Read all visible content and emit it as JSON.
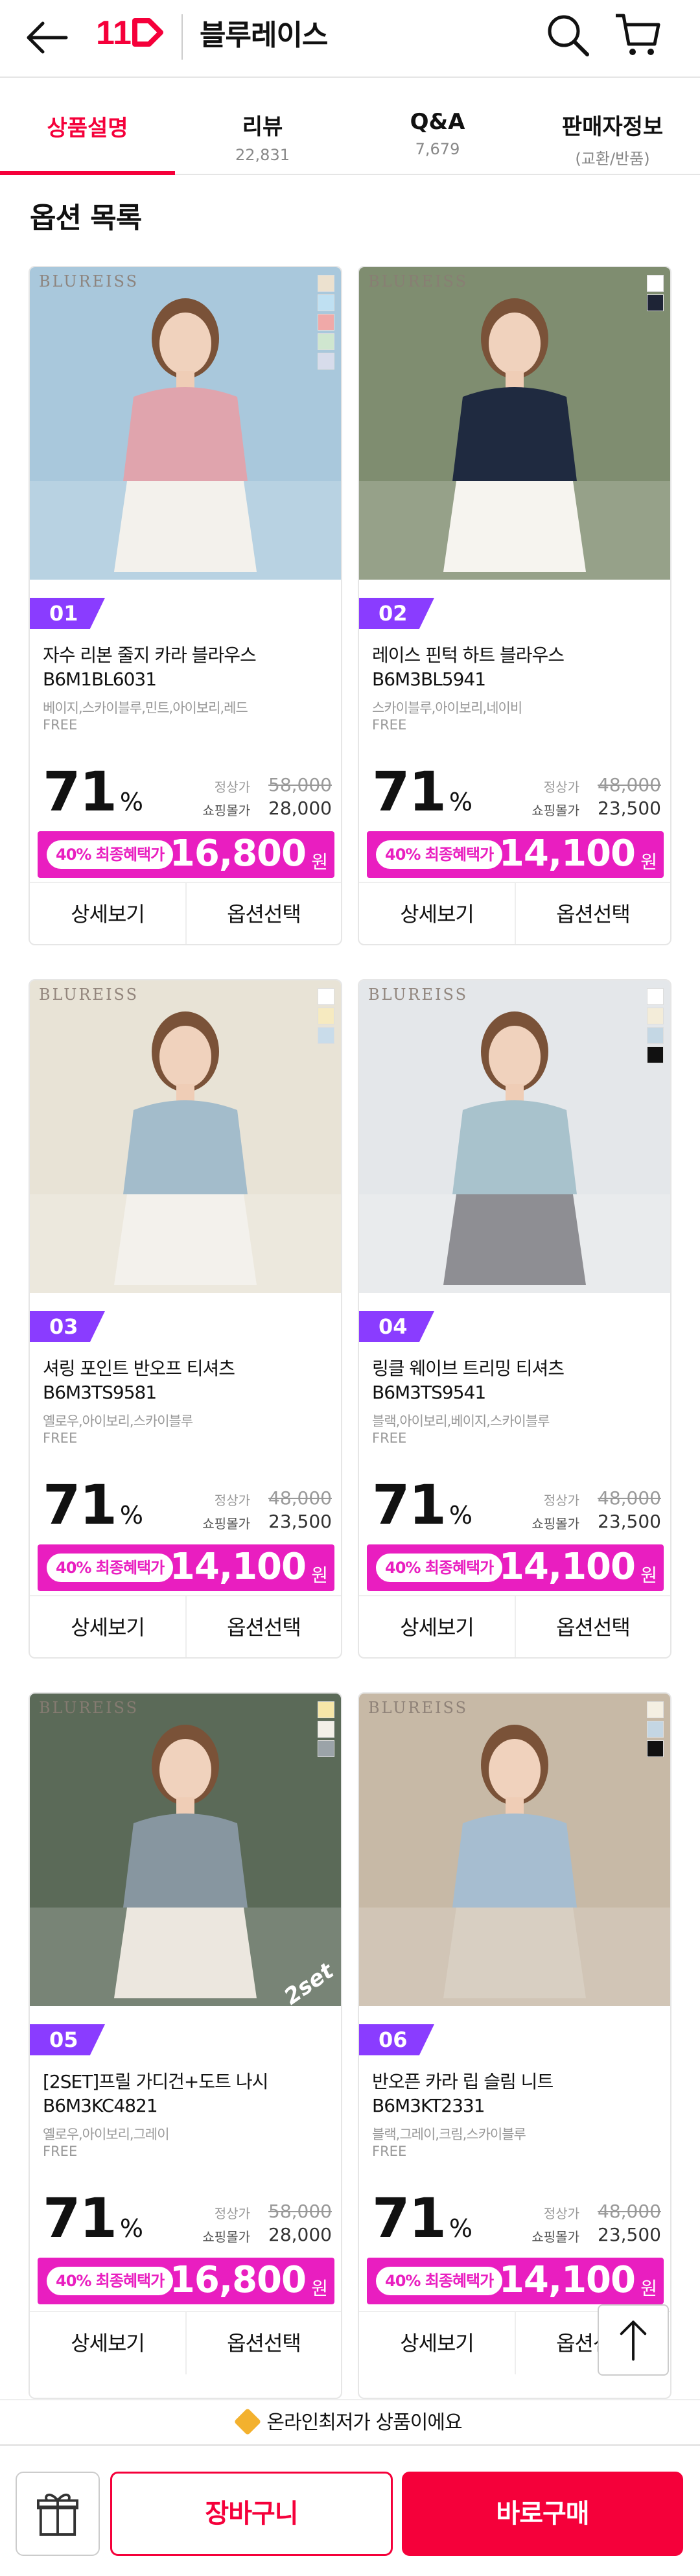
{
  "header": {
    "logo_text": "11",
    "store_name": "블루레이스"
  },
  "tabs": [
    {
      "label": "상품설명",
      "sub": ""
    },
    {
      "label": "리뷰",
      "sub": "22,831"
    },
    {
      "label": "Q&A",
      "sub": "7,679"
    },
    {
      "label": "판매자정보",
      "sub": "(교환/반품)"
    }
  ],
  "section_title": "옵션 목록",
  "labels": {
    "regular": "정상가",
    "shopping": "쇼핑몰가",
    "benefit": "40% 최종혜택가",
    "won": "원",
    "percent": "%",
    "detail": "상세보기",
    "option": "옵션선택"
  },
  "products": [
    {
      "no": "01",
      "name": "자수 리본 줄지 카라 블라우스 B6M1BL6031",
      "colors": "베이지,스카이블루,민트,아이보리,레드",
      "size": "FREE",
      "discount": "71",
      "regular": "58,000",
      "shop": "28,000",
      "final": "16,800",
      "brand": "BLUREISS",
      "set": "",
      "swatch_colors": [
        "#ece1cf",
        "#bfe0f2",
        "#f0a9a8",
        "#cfe6cf",
        "#d7dceb"
      ],
      "photo_bg": "#a9c8dc",
      "outfit": "#e0a4ad",
      "bottom": "#f3f1ec"
    },
    {
      "no": "02",
      "name": "레이스 핀턱 하트 블라우스 B6M3BL5941",
      "colors": "스카이블루,아이보리,네이비",
      "size": "FREE",
      "discount": "71",
      "regular": "48,000",
      "shop": "23,500",
      "final": "14,100",
      "brand": "BLUREISS",
      "set": "",
      "swatch_colors": [
        "#ffffff",
        "#1e2436"
      ],
      "photo_bg": "#7f8d70",
      "outfit": "#1f2a40",
      "bottom": "#f6f4ef"
    },
    {
      "no": "03",
      "name": "셔링 포인트 반오프 티셔츠 B6M3TS9581",
      "colors": "옐로우,아이보리,스카이블루",
      "size": "FREE",
      "discount": "71",
      "regular": "48,000",
      "shop": "23,500",
      "final": "14,100",
      "brand": "BLUREISS",
      "set": "",
      "swatch_colors": [
        "#ffffff",
        "#f6eac0",
        "#c9dcea"
      ],
      "photo_bg": "#e8e3d6",
      "outfit": "#a3bccb",
      "bottom": "#f3f1ec"
    },
    {
      "no": "04",
      "name": "링클 웨이브 트리밍 티셔츠 B6M3TS9541",
      "colors": "블랙,아이보리,베이지,스카이블루",
      "size": "FREE",
      "discount": "71",
      "regular": "48,000",
      "shop": "23,500",
      "final": "14,100",
      "brand": "BLUREISS",
      "set": "",
      "swatch_colors": [
        "#ffffff",
        "#f3ecd9",
        "#c4d7e4",
        "#111111"
      ],
      "photo_bg": "#e4e7ea",
      "outfit": "#a8c2cc",
      "bottom": "#8e8e93"
    },
    {
      "no": "05",
      "name": "[2SET]프릴 가디건+도트 나시 B6M3KC4821",
      "colors": "옐로우,아이보리,그레이",
      "size": "FREE",
      "discount": "71",
      "regular": "58,000",
      "shop": "28,000",
      "final": "16,800",
      "brand": "BLUREISS",
      "set": "2set",
      "swatch_colors": [
        "#f6e6a8",
        "#f3f0e8",
        "#9ba3a8"
      ],
      "photo_bg": "#5b6a58",
      "outfit": "#8796a0",
      "bottom": "#ece7df"
    },
    {
      "no": "06",
      "name": "반오픈 카라 립 슬림 니트 B6M3KT2331",
      "colors": "블랙,그레이,크림,스카이블루",
      "size": "FREE",
      "discount": "71",
      "regular": "48,000",
      "shop": "23,500",
      "final": "14,100",
      "brand": "BLUREISS",
      "set": "",
      "swatch_colors": [
        "#f4efe2",
        "#c4d6e3",
        "#111111"
      ],
      "photo_bg": "#c7b9a6",
      "outfit": "#a6bdd0",
      "bottom": "#d8cfc2"
    }
  ],
  "bottom": {
    "lowest_text": "온라인최저가 상품이에요",
    "cart": "장바구니",
    "buy": "바로구매"
  }
}
